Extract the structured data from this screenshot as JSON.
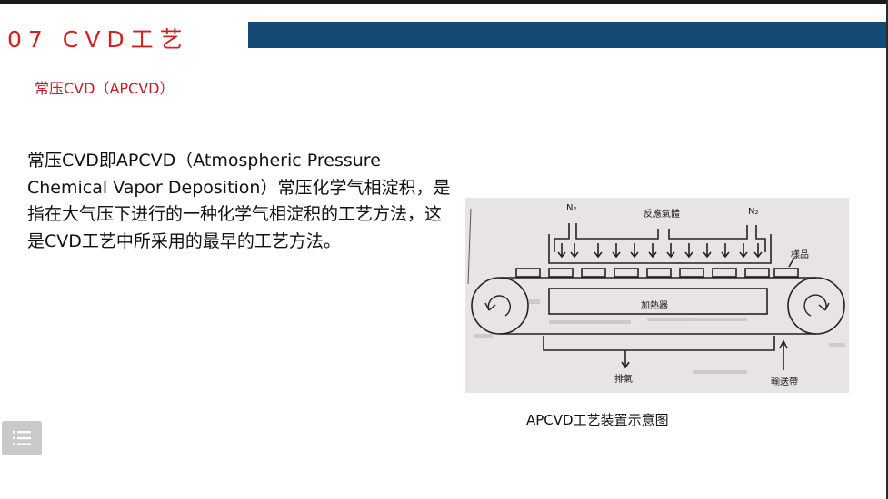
{
  "slide": {
    "title": "07 CVD工艺",
    "subtitle": "常压CVD（APCVD）",
    "body": "常压CVD即APCVD（Atmospheric Pressure Chemical Vapor Deposition）常压化学气相淀积，是指在大气压下进行的一种化学气相淀积的工艺方法，这是CVD工艺中所采用的最早的工艺方法。"
  },
  "diagram": {
    "labels": {
      "n2_left": "N₂",
      "reactant_gas": "反應氣體",
      "n2_right": "N₂",
      "sample": "樣品",
      "heater": "加熱器",
      "exhaust": "排氣",
      "conveyor": "輸送帶"
    },
    "caption": "APCVD工艺装置示意图"
  },
  "controls": {
    "menu_icon": "list-menu-icon"
  },
  "colors": {
    "title_red": "#d42020",
    "title_bar": "#144a74",
    "subtitle_red": "#c0202a"
  }
}
